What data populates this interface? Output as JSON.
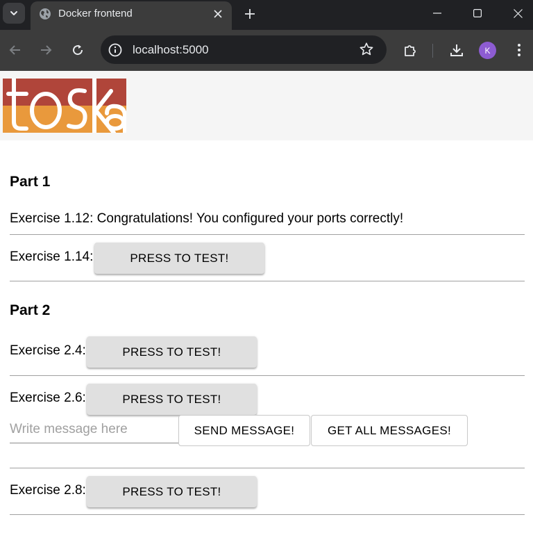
{
  "browser": {
    "tab_title": "Docker frontend",
    "url": "localhost:5000",
    "profile_initial": "K"
  },
  "logo": {
    "text": "toska",
    "colors": {
      "top": "#b0453a",
      "bottom": "#e9993c"
    }
  },
  "part1": {
    "heading": "Part 1",
    "ex_1_12": "Exercise 1.12: Congratulations! You configured your ports correctly!",
    "ex_1_14_label": "Exercise 1.14:",
    "ex_1_14_button": "PRESS TO TEST!"
  },
  "part2": {
    "heading": "Part 2",
    "ex_2_4_label": "Exercise 2.4:",
    "ex_2_4_button": "PRESS TO TEST!",
    "ex_2_6_label": "Exercise 2.6:",
    "ex_2_6_button": "PRESS TO TEST!",
    "message_placeholder": "Write message here",
    "message_value": "",
    "send_button": "SEND MESSAGE!",
    "get_all_button": "GET ALL MESSAGES!",
    "ex_2_8_label": "Exercise 2.8:",
    "ex_2_8_button": "PRESS TO TEST!"
  }
}
